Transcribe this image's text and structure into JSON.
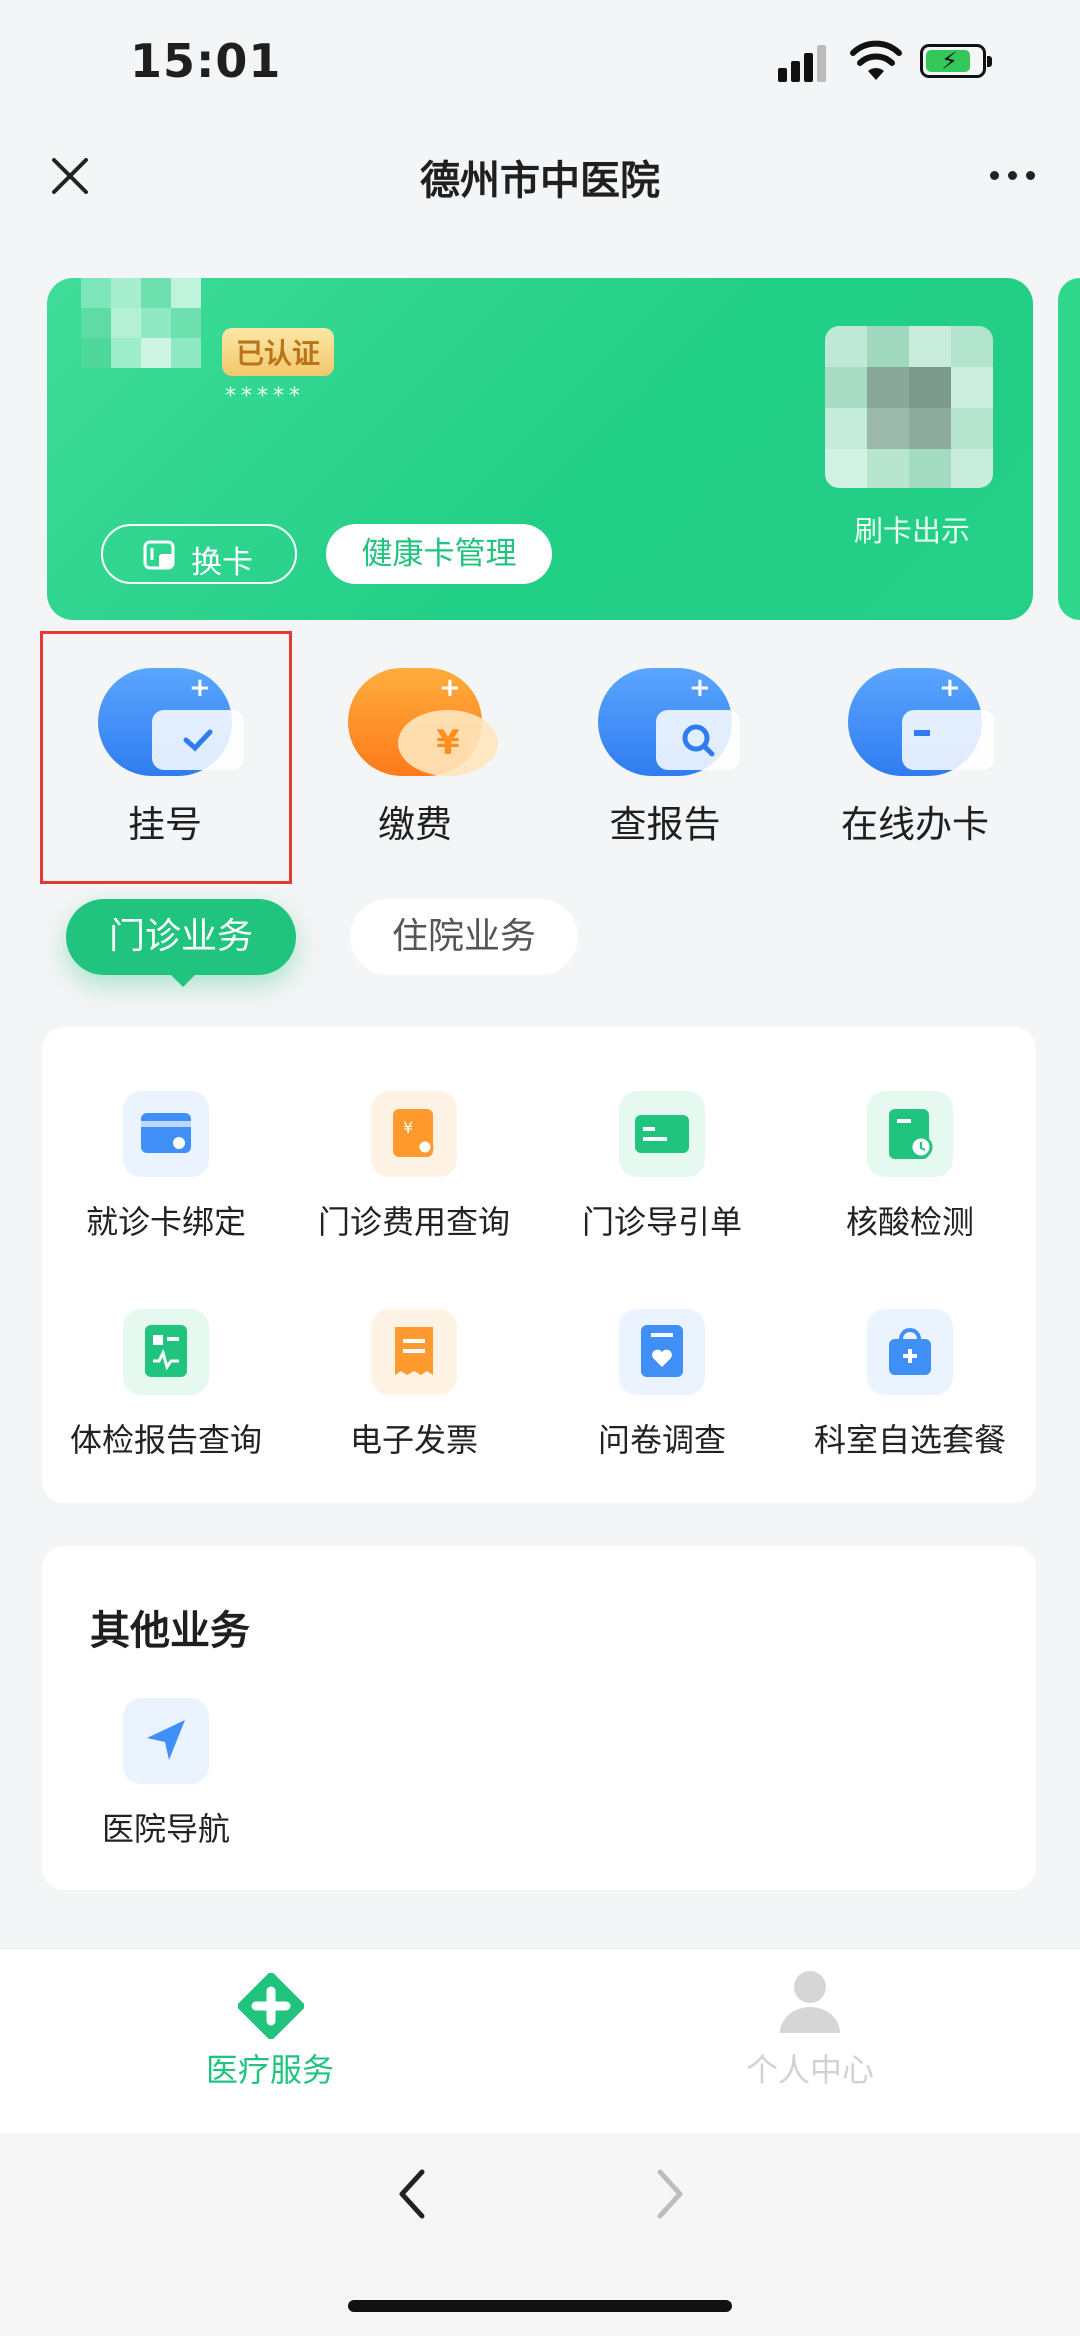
{
  "status_bar": {
    "time": "15:01"
  },
  "nav": {
    "title": "德州市中医院"
  },
  "health_card": {
    "verified_badge": "已认证",
    "masked_id": "*****",
    "scan_label": "刷卡出示",
    "swap_label": "换卡",
    "manage_label": "健康卡管理"
  },
  "quick_actions": [
    {
      "label": "挂号",
      "icon": "register-icon",
      "color": "#3f8ff7"
    },
    {
      "label": "缴费",
      "icon": "payment-yuan-icon",
      "color": "#ff8f1f"
    },
    {
      "label": "查报告",
      "icon": "report-search-icon",
      "color": "#3f8ff7"
    },
    {
      "label": "在线办卡",
      "icon": "card-apply-icon",
      "color": "#3f8ff7"
    }
  ],
  "tabs": {
    "active": "门诊业务",
    "inactive": "住院业务"
  },
  "outpatient_services": [
    {
      "label": "就诊卡绑定",
      "icon": "card-bind-icon",
      "color": "#3f8ff7"
    },
    {
      "label": "门诊费用查询",
      "icon": "fee-query-icon",
      "color": "#ff9a2e"
    },
    {
      "label": "门诊导引单",
      "icon": "guide-sheet-icon",
      "color": "#21c47f"
    },
    {
      "label": "核酸检测",
      "icon": "nucleic-test-icon",
      "color": "#21c47f"
    },
    {
      "label": "体检报告查询",
      "icon": "checkup-report-icon",
      "color": "#21c47f"
    },
    {
      "label": "电子发票",
      "icon": "e-invoice-icon",
      "color": "#ff9a2e"
    },
    {
      "label": "问卷调查",
      "icon": "survey-icon",
      "color": "#3f8ff7"
    },
    {
      "label": "科室自选套餐",
      "icon": "package-bag-icon",
      "color": "#3f8ff7"
    }
  ],
  "other_services": {
    "title": "其他业务",
    "items": [
      {
        "label": "医院导航",
        "icon": "navigation-arrow-icon",
        "color": "#3f8ff7"
      }
    ]
  },
  "tabbar": [
    {
      "label": "医疗服务",
      "icon": "medical-cross-icon",
      "active": true,
      "color": "#21c47f"
    },
    {
      "label": "个人中心",
      "icon": "person-icon",
      "active": false,
      "color": "#d6d6d6"
    }
  ]
}
